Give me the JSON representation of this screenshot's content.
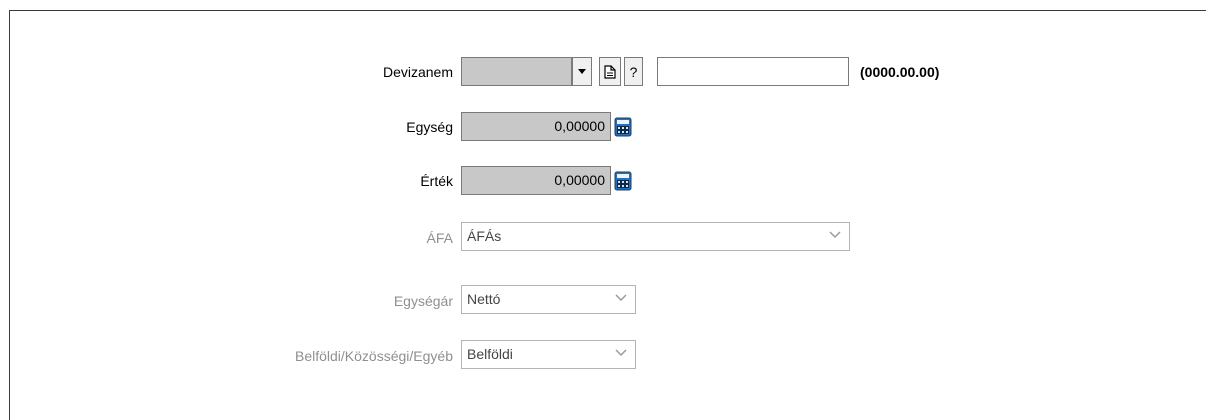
{
  "frame": {},
  "devizanem": {
    "label": "Devizanem",
    "value": "",
    "dropdown_icon": "caret-down-icon",
    "doc_icon": "document-icon",
    "help_label": "?",
    "text_value": "",
    "date_hint": "(0000.00.00)"
  },
  "egyseg": {
    "label": "Egység",
    "value": "0,00000",
    "calc_icon": "calculator-icon"
  },
  "ertek": {
    "label": "Érték",
    "value": "0,00000",
    "calc_icon": "calculator-icon"
  },
  "afa": {
    "label": "ÁFA",
    "selected": "ÁFÁs"
  },
  "egysegar": {
    "label": "Egységár",
    "selected": "Nettó"
  },
  "belfoldi": {
    "label": "Belföldi/Közösségi/Egyéb",
    "selected": "Belföldi"
  },
  "colors": {
    "disabled_field": "#c8c8c8",
    "disabled_text": "#8f8f8f",
    "border": "#7a7a7a"
  }
}
